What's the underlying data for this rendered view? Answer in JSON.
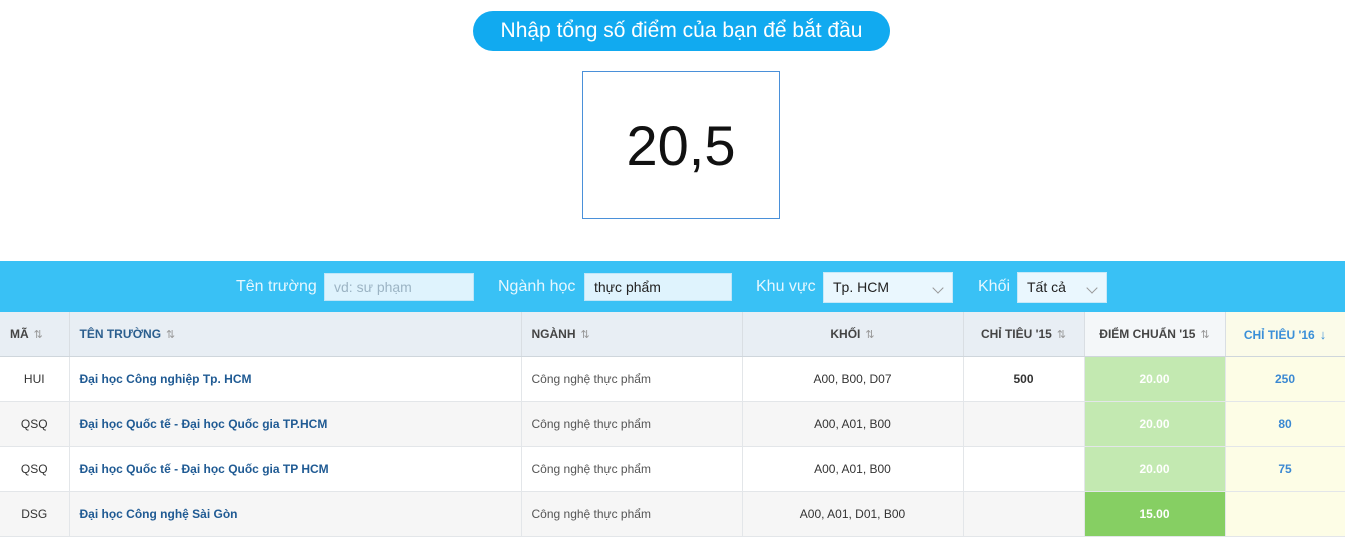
{
  "header": {
    "prompt": "Nhập tổng số điểm của bạn để bắt đầu",
    "score": "20,5"
  },
  "filters": {
    "ten_truong_label": "Tên trường",
    "ten_truong_placeholder": "vd: sư phạm",
    "nganh_label": "Ngành học",
    "nganh_value": "thực phẩm",
    "khu_vuc_label": "Khu vực",
    "khu_vuc_value": "Tp. HCM",
    "khoi_label": "Khối",
    "khoi_value": "Tất cả"
  },
  "table": {
    "headers": {
      "ma": "MÃ",
      "ten_truong": "TÊN TRƯỜNG",
      "nganh": "NGÀNH",
      "khoi": "KHỐI",
      "chi_tieu_15": "CHỈ TIÊU '15",
      "diem_chuan_15": "ĐIỂM CHUẨN '15",
      "chi_tieu_16": "CHỈ TIÊU '16"
    },
    "rows": [
      {
        "ma": "HUI",
        "ten_truong": "Đại học Công nghiệp Tp. HCM",
        "nganh": "Công nghệ thực phẩm",
        "khoi": "A00, B00, D07",
        "chi_tieu_15": "500",
        "diem_chuan_15": "20.00",
        "chi_tieu_16": "250"
      },
      {
        "ma": "QSQ",
        "ten_truong": "Đại học Quốc tế - Đại học Quốc gia TP.HCM",
        "nganh": "Công nghệ thực phẩm",
        "khoi": "A00, A01, B00",
        "chi_tieu_15": "",
        "diem_chuan_15": "20.00",
        "chi_tieu_16": "80"
      },
      {
        "ma": "QSQ",
        "ten_truong": "Đại học Quốc tế - Đại học Quốc gia TP HCM",
        "nganh": "Công nghệ thực phẩm",
        "khoi": "A00, A01, B00",
        "chi_tieu_15": "",
        "diem_chuan_15": "20.00",
        "chi_tieu_16": "75"
      },
      {
        "ma": "DSG",
        "ten_truong": "Đại học Công nghệ Sài Gòn",
        "nganh": "Công nghệ thực phẩm",
        "khoi": "A00, A01, D01, B00",
        "chi_tieu_15": "",
        "diem_chuan_15": "15.00",
        "chi_tieu_16": ""
      }
    ]
  },
  "colors": {
    "brand_blue": "#11aaf0",
    "filter_bar": "#39c1f5",
    "pass_green_light": "#c3e9b1",
    "pass_green_dark": "#86cf63",
    "quota_yellow": "#fdfde6"
  },
  "icons": {
    "sort": "sort-icon",
    "sort_desc": "arrow-down-icon",
    "dropdown": "chevron-down-icon"
  }
}
